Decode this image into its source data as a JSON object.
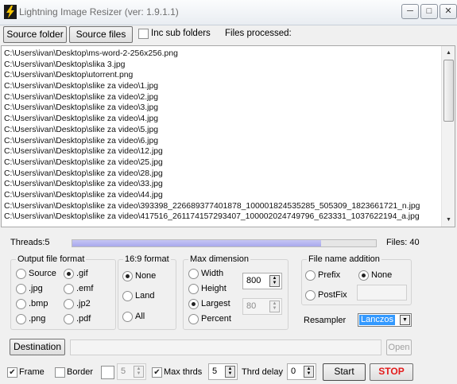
{
  "window": {
    "title": "Lightning Image Resizer (ver: 1.9.1.1)",
    "icon": "lightning-icon",
    "controls": {
      "minimize": "─",
      "maximize": "□",
      "close": "✕"
    }
  },
  "toolbar": {
    "source_folder": "Source folder",
    "source_files": "Source files",
    "inc_sub_folders": "Inc sub folders",
    "inc_sub_folders_checked": false,
    "files_processed_label": "Files processed:"
  },
  "file_list": [
    "C:\\Users\\ivan\\Desktop\\ms-word-2-256x256.png",
    "C:\\Users\\ivan\\Desktop\\slika 3.jpg",
    "C:\\Users\\ivan\\Desktop\\utorrent.png",
    "C:\\Users\\ivan\\Desktop\\slike za video\\1.jpg",
    "C:\\Users\\ivan\\Desktop\\slike za video\\2.jpg",
    "C:\\Users\\ivan\\Desktop\\slike za video\\3.jpg",
    "C:\\Users\\ivan\\Desktop\\slike za video\\4.jpg",
    "C:\\Users\\ivan\\Desktop\\slike za video\\5.jpg",
    "C:\\Users\\ivan\\Desktop\\slike za video\\6.jpg",
    "C:\\Users\\ivan\\Desktop\\slike za video\\12.jpg",
    "C:\\Users\\ivan\\Desktop\\slike za video\\25.jpg",
    "C:\\Users\\ivan\\Desktop\\slike za video\\28.jpg",
    "C:\\Users\\ivan\\Desktop\\slike za video\\33.jpg",
    "C:\\Users\\ivan\\Desktop\\slike za video\\44.jpg",
    "C:\\Users\\ivan\\Desktop\\slike za video\\393398_226689377401878_100001824535285_505309_1823661721_n.jpg",
    "C:\\Users\\ivan\\Desktop\\slike za video\\417516_261174157293407_100002024749796_623331_1037622194_a.jpg"
  ],
  "status": {
    "threads": "Threads:5",
    "files": "Files: 40",
    "progress": 0.82
  },
  "output_format": {
    "title": "Output file format",
    "options": [
      "Source",
      ".gif",
      ".jpg",
      ".emf",
      ".bmp",
      ".jp2",
      ".png",
      ".pdf"
    ],
    "selected": ".gif"
  },
  "aspect": {
    "title": "16:9 format",
    "options": [
      "None",
      "Land",
      "All"
    ],
    "selected": "None"
  },
  "max_dimension": {
    "title": "Max dimension",
    "options": [
      "Width",
      "Height",
      "Largest",
      "Percent"
    ],
    "selected": "Largest",
    "value": "800",
    "percent_value": "80"
  },
  "file_name_addition": {
    "title": "File name addition",
    "options": [
      "Prefix",
      "None",
      "PostFix"
    ],
    "selected": "None",
    "value": ""
  },
  "resampler": {
    "label": "Resampler",
    "value": "Lanczos"
  },
  "destination": {
    "button": "Destination",
    "path": "",
    "open": "Open"
  },
  "bottom": {
    "frame_label": "Frame",
    "frame_checked": true,
    "border_label": "Border",
    "border_checked": false,
    "border_value": "5",
    "max_thrds_label": "Max thrds",
    "max_thrds_checked": true,
    "threads_value": "5",
    "thrd_delay_label": "Thrd delay",
    "thrd_delay_value": "0",
    "start": "Start",
    "stop": "STOP"
  }
}
